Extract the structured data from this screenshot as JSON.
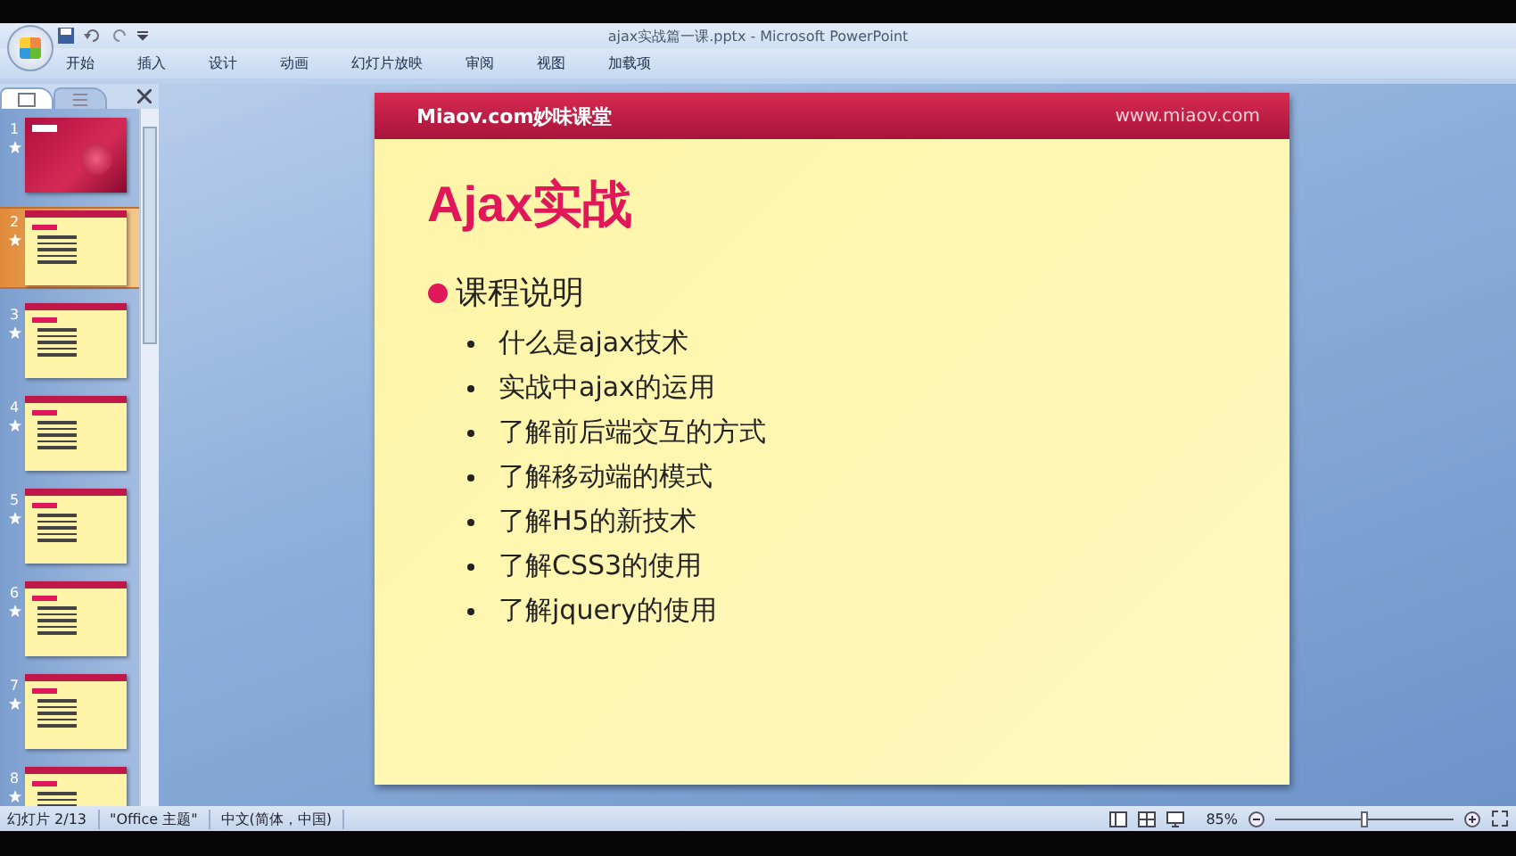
{
  "window": {
    "title": "ajax实战篇一课.pptx - Microsoft PowerPoint"
  },
  "ribbon_tabs": [
    {
      "label": "开始",
      "selected": false
    },
    {
      "label": "插入",
      "selected": false
    },
    {
      "label": "设计",
      "selected": false
    },
    {
      "label": "动画",
      "selected": false
    },
    {
      "label": "幻灯片放映",
      "selected": false
    },
    {
      "label": "审阅",
      "selected": false
    },
    {
      "label": "视图",
      "selected": false
    },
    {
      "label": "加载项",
      "selected": false
    }
  ],
  "thumbnails": [
    {
      "number": "1",
      "kind": "title",
      "selected": false
    },
    {
      "number": "2",
      "kind": "content",
      "selected": true
    },
    {
      "number": "3",
      "kind": "content",
      "selected": false
    },
    {
      "number": "4",
      "kind": "content",
      "selected": false
    },
    {
      "number": "5",
      "kind": "content",
      "selected": false
    },
    {
      "number": "6",
      "kind": "content",
      "selected": false
    },
    {
      "number": "7",
      "kind": "content",
      "selected": false
    },
    {
      "number": "8",
      "kind": "content",
      "selected": false
    }
  ],
  "slide": {
    "logo": "Miaov.com妙味课堂",
    "url": "www.miaov.com",
    "title": "Ajax实战",
    "heading": "课程说明",
    "bullets": [
      "什么是ajax技术",
      "实战中ajax的运用",
      "了解前后端交互的方式",
      "了解移动端的模式",
      "了解H5的新技术",
      "了解CSS3的使用",
      "了解jquery的使用"
    ]
  },
  "status_bar": {
    "slide": "幻灯片 2/13",
    "theme": "\"Office 主题\"",
    "language": "中文(简体，中国)",
    "zoom": "85%",
    "zoom_slider": {
      "level": 0.5
    }
  }
}
